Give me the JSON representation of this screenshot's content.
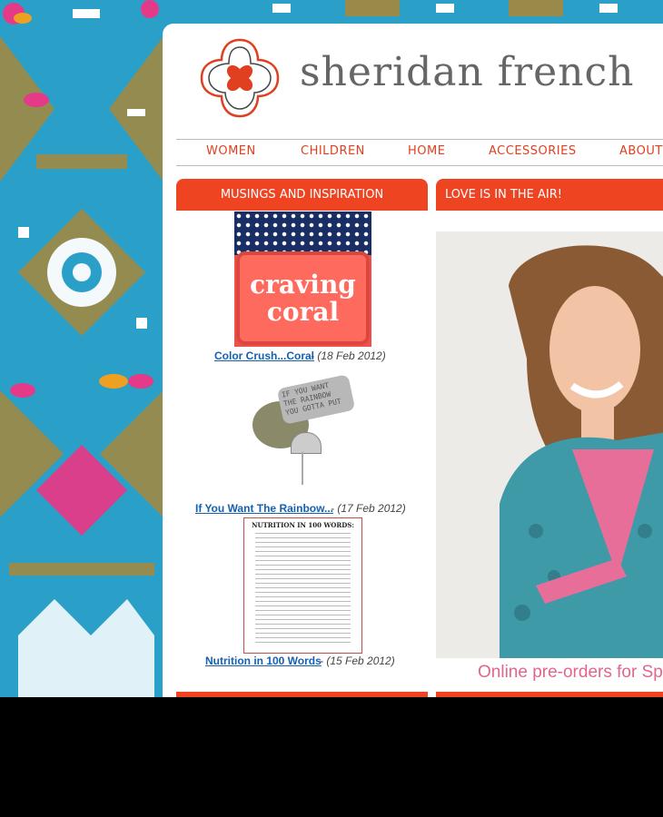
{
  "brand": {
    "name": "sheridan french"
  },
  "nav": {
    "items": [
      "WOMEN",
      "CHILDREN",
      "HOME",
      "ACCESSORIES",
      "ABOUT"
    ]
  },
  "musings": {
    "heading": "MUSINGS AND INSPIRATION",
    "posts": [
      {
        "title": "Color Crush...Coral",
        "date": " - (18 Feb 2012)",
        "image_text": [
          "craving",
          "coral"
        ]
      },
      {
        "title": "If You Want The Rainbow...",
        "date": " - (17 Feb 2012)",
        "image_text": [
          "IF YOU WANT",
          "THE RAINBOW",
          "YOU GOTTA PUT"
        ]
      },
      {
        "title": "Nutrition in 100 Words",
        "date": " - (15 Feb 2012)",
        "image_text": [
          "NUTRITION IN 100 WORDS:"
        ]
      }
    ]
  },
  "feature": {
    "heading": "LOVE IS IN THE AIR!",
    "caption": "Online pre-orders for Sp"
  },
  "colors": {
    "accent": "#ee4422",
    "link": "#1560b0",
    "pink": "#e0668a"
  }
}
